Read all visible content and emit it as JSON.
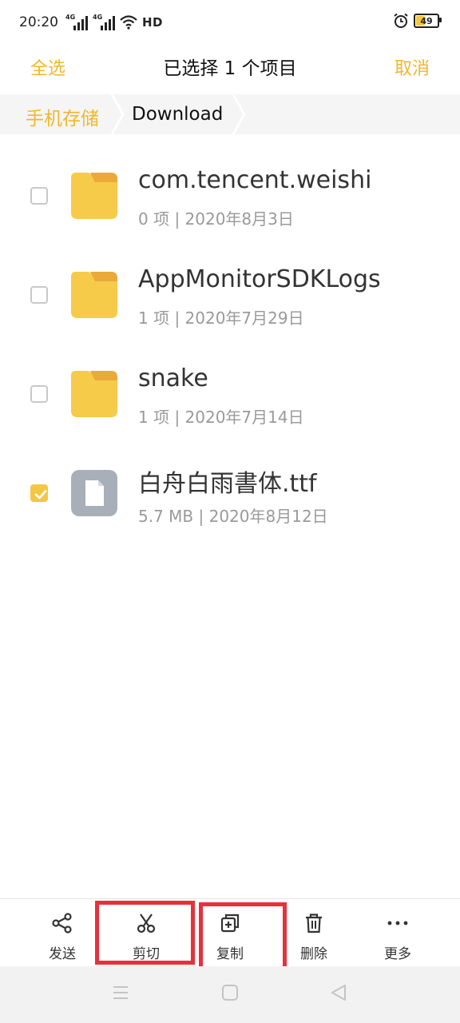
{
  "status_bar": {
    "time": "20:20",
    "network_1": "4G",
    "network_2": "4G",
    "hd": "HD",
    "battery": "49"
  },
  "header": {
    "select_all": "全选",
    "title": "已选择 1 个项目",
    "cancel": "取消"
  },
  "breadcrumb": {
    "root": "手机存储",
    "current": "Download"
  },
  "files": [
    {
      "name": "com.tencent.weishi",
      "meta": "0 项 | 2020年8月3日",
      "type": "folder",
      "checked": false
    },
    {
      "name": "AppMonitorSDKLogs",
      "meta": "1 项 | 2020年7月29日",
      "type": "folder",
      "checked": false
    },
    {
      "name": "snake",
      "meta": "1 项 | 2020年7月14日",
      "type": "folder",
      "checked": false
    },
    {
      "name": "白舟白雨書体.ttf",
      "meta": "5.7 MB | 2020年8月12日",
      "type": "file",
      "checked": true
    }
  ],
  "toolbar": {
    "send": "发送",
    "cut": "剪切",
    "copy": "复制",
    "delete": "删除",
    "more": "更多"
  },
  "colors": {
    "accent": "#f0b82a",
    "folder": "#f6cb4a",
    "highlight_box": "#e8303b"
  }
}
